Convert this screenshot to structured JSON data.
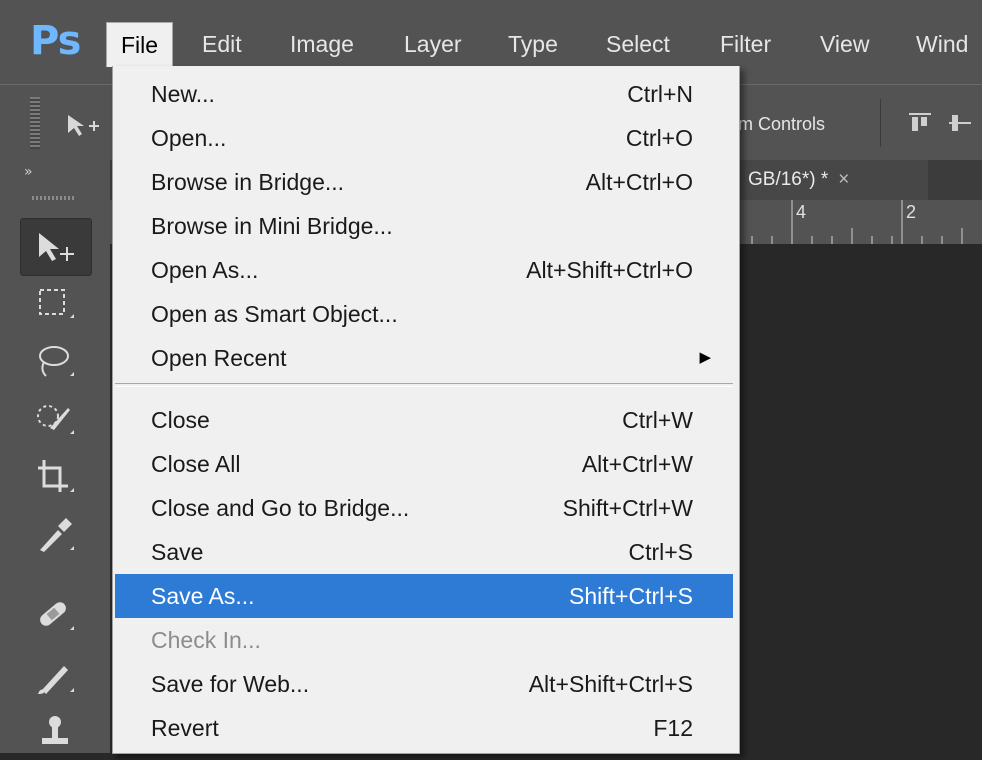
{
  "app": {
    "logo": "Ps"
  },
  "menubar": {
    "items": [
      {
        "label": "File"
      },
      {
        "label": "Edit"
      },
      {
        "label": "Image"
      },
      {
        "label": "Layer"
      },
      {
        "label": "Type"
      },
      {
        "label": "Select"
      },
      {
        "label": "Filter"
      },
      {
        "label": "View"
      },
      {
        "label": "Wind"
      }
    ]
  },
  "options_bar": {
    "transform_controls_label": "m Controls"
  },
  "document_tab": {
    "title": "GB/16*) *",
    "close": "×"
  },
  "ruler": {
    "labels": [
      "4",
      "2"
    ]
  },
  "toolbox": {
    "collapse": "»",
    "tools": [
      "move-tool",
      "rectangular-marquee-tool",
      "lasso-tool",
      "quick-selection-tool",
      "crop-tool",
      "eyedropper-tool",
      "spot-healing-brush-tool",
      "brush-tool",
      "clone-stamp-tool"
    ]
  },
  "file_menu": {
    "items": [
      {
        "label": "New...",
        "shortcut": "Ctrl+N"
      },
      {
        "label": "Open...",
        "shortcut": "Ctrl+O"
      },
      {
        "label": "Browse in Bridge...",
        "shortcut": "Alt+Ctrl+O"
      },
      {
        "label": "Browse in Mini Bridge...",
        "shortcut": ""
      },
      {
        "label": "Open As...",
        "shortcut": "Alt+Shift+Ctrl+O"
      },
      {
        "label": "Open as Smart Object...",
        "shortcut": ""
      },
      {
        "label": "Open Recent",
        "shortcut": "",
        "submenu_arrow": "▶"
      },
      {
        "label": "Close",
        "shortcut": "Ctrl+W"
      },
      {
        "label": "Close All",
        "shortcut": "Alt+Ctrl+W"
      },
      {
        "label": "Close and Go to Bridge...",
        "shortcut": "Shift+Ctrl+W"
      },
      {
        "label": "Save",
        "shortcut": "Ctrl+S"
      },
      {
        "label": "Save As...",
        "shortcut": "Shift+Ctrl+S",
        "highlighted": true
      },
      {
        "label": "Check In...",
        "shortcut": "",
        "disabled": true
      },
      {
        "label": "Save for Web...",
        "shortcut": "Alt+Shift+Ctrl+S"
      },
      {
        "label": "Revert",
        "shortcut": "F12"
      }
    ]
  },
  "colors": {
    "highlight": "#2e7bd6",
    "logo": "#6fb7ff",
    "chrome": "#535353",
    "canvas": "#282828"
  }
}
